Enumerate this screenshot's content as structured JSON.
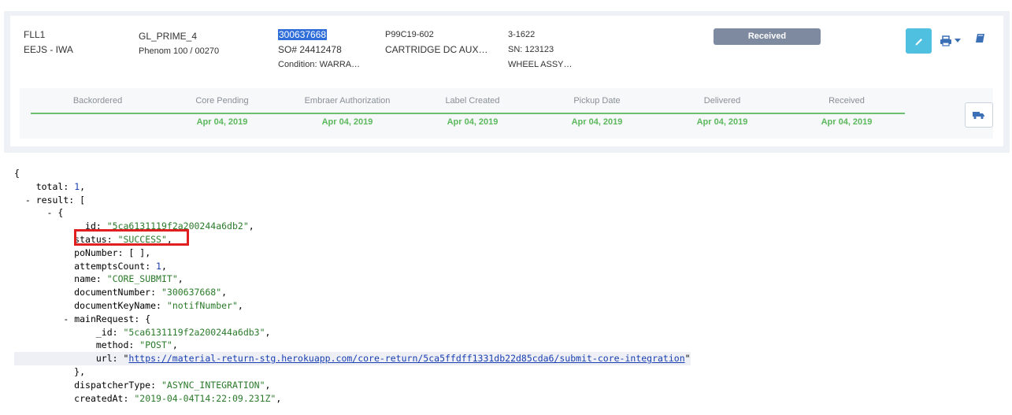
{
  "order": {
    "location_code": "FLL1",
    "location_name": "EEJS - IWA",
    "aircraft": "GL_PRIME_4",
    "aircraft_detail": "Phenom 100 / 00270",
    "document_number": "300637668",
    "so_number": "SO# 24412478",
    "condition": "Condition: WARRA…",
    "part_number": "P99C19-602",
    "part_description": "CARTRIDGE DC AUX…",
    "item_code": "3-1622",
    "serial_number": "SN: 123123",
    "item_description": "WHEEL ASSY…",
    "status_badge": "Received"
  },
  "tracking": {
    "stages": [
      {
        "label": "Backordered",
        "date": ""
      },
      {
        "label": "Core Pending",
        "date": "Apr 04, 2019"
      },
      {
        "label": "Embraer Authorization",
        "date": "Apr 04, 2019"
      },
      {
        "label": "Label Created",
        "date": "Apr 04, 2019"
      },
      {
        "label": "Pickup Date",
        "date": "Apr 04, 2019"
      },
      {
        "label": "Delivered",
        "date": "Apr 04, 2019"
      },
      {
        "label": "Received",
        "date": "Apr 04, 2019"
      }
    ]
  },
  "icons": {
    "edit": "pencil-icon",
    "print": "printer-icon",
    "book": "book-icon",
    "truck": "truck-icon"
  },
  "colors": {
    "edit_button": "#4fc0e0",
    "badge": "#7d8aa0",
    "track_green": "#5cb85c",
    "highlight_box": "#e02020"
  },
  "json_view": {
    "open_brace": "{",
    "total_key": "total",
    "total_value": "1",
    "result_key": "result",
    "id_key": "_id",
    "id_value": "\"5ca6131119f2a200244a6db2\"",
    "status_key": "status",
    "status_value": "\"SUCCESS\"",
    "poNumber_key": "poNumber",
    "poNumber_value": "[ ]",
    "attemptsCount_key": "attemptsCount",
    "attemptsCount_value": "1",
    "name_key": "name",
    "name_value": "\"CORE_SUBMIT\"",
    "documentNumber_key": "documentNumber",
    "documentNumber_value": "\"300637668\"",
    "documentKeyName_key": "documentKeyName",
    "documentKeyName_value": "\"notifNumber\"",
    "mainRequest_key": "mainRequest",
    "mr_id_key": "_id",
    "mr_id_value": "\"5ca6131119f2a200244a6db3\"",
    "method_key": "method",
    "method_value": "\"POST\"",
    "url_key": "url",
    "url_value": "https://material-return-stg.herokuapp.com/core-return/5ca5ffdff1331db22d85cda6/submit-core-integration",
    "dispatcherType_key": "dispatcherType",
    "dispatcherType_value": "\"ASYNC_INTEGRATION\"",
    "createdAt_key": "createdAt",
    "createdAt_value": "\"2019-04-04T14:22:09.231Z\""
  }
}
